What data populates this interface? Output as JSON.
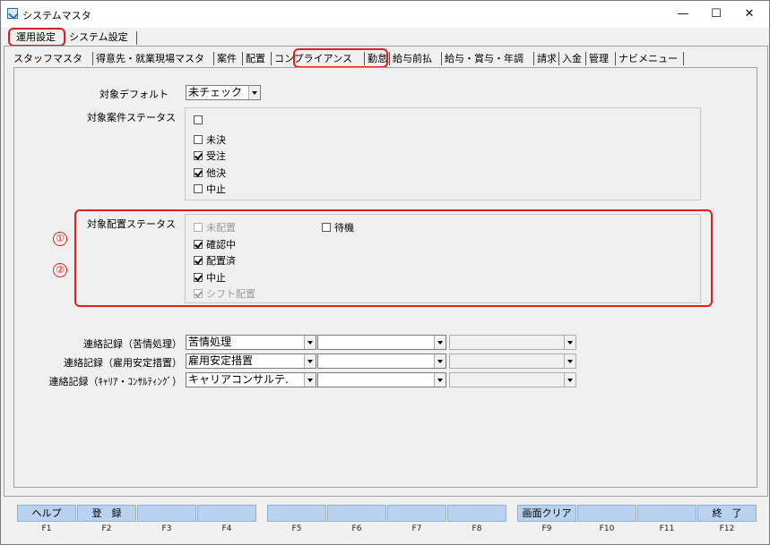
{
  "window": {
    "title": "システムマスタ",
    "minimize": "—",
    "maximize": "☐",
    "close": "✕"
  },
  "top_tabs": [
    {
      "label": "運用設定"
    },
    {
      "label": "システム設定"
    }
  ],
  "sub_tabs": [
    "スタッフマスタ",
    "得意先・就業現場マスタ",
    "案件",
    "配置",
    "コンプライアンス",
    "勤怠",
    "給与前払",
    "給与・賞与・年調",
    "請求",
    "入金",
    "管理",
    "ナビメニュー"
  ],
  "form": {
    "target_default_label": "対象デフォルト",
    "target_default_value": "未チェック",
    "case_status_label": "対象案件ステータス",
    "case_status_items": [
      {
        "label": "",
        "checked": false
      },
      {
        "label": "未決",
        "checked": false
      },
      {
        "label": "受注",
        "checked": true
      },
      {
        "label": "他決",
        "checked": true
      },
      {
        "label": "中止",
        "checked": false
      }
    ],
    "placement_status_label": "対象配置ステータス",
    "placement_left": [
      {
        "label": "未配置",
        "checked": false,
        "disabled": true
      },
      {
        "label": "確認中",
        "checked": true,
        "disabled": false
      },
      {
        "label": "配置済",
        "checked": true,
        "disabled": false
      },
      {
        "label": "中止",
        "checked": true,
        "disabled": false
      },
      {
        "label": "シフト配置",
        "checked": true,
        "disabled": true
      }
    ],
    "placement_right": {
      "label": "待機",
      "checked": false
    },
    "annotations": [
      "①",
      "②"
    ],
    "contact_rows": [
      {
        "label": "連絡記録（苦情処理）",
        "v1": "苦情処理",
        "v2": "",
        "v3": ""
      },
      {
        "label": "連絡記録（雇用安定措置）",
        "v1": "雇用安定措置",
        "v2": "",
        "v3": ""
      },
      {
        "label": "連絡記録（ｷｬﾘｱ・ｺﾝｻﾙﾃｨﾝｸﾞ）",
        "v1": "キャリアコンサルテ.",
        "v2": "",
        "v3": ""
      }
    ]
  },
  "fkeys": [
    {
      "label": "ヘルプ",
      "key": "F1"
    },
    {
      "label": "登　録",
      "key": "F2"
    },
    {
      "label": "",
      "key": "F3"
    },
    {
      "label": "",
      "key": "F4"
    },
    {
      "label": "",
      "key": "F5"
    },
    {
      "label": "",
      "key": "F6"
    },
    {
      "label": "",
      "key": "F7"
    },
    {
      "label": "",
      "key": "F8"
    },
    {
      "label": "画面クリア",
      "key": "F9"
    },
    {
      "label": "",
      "key": "F10"
    },
    {
      "label": "",
      "key": "F11"
    },
    {
      "label": "終　了",
      "key": "F12"
    }
  ],
  "colors": {
    "highlight": "#e02020",
    "fkey_bg": "#b8d2f0"
  }
}
